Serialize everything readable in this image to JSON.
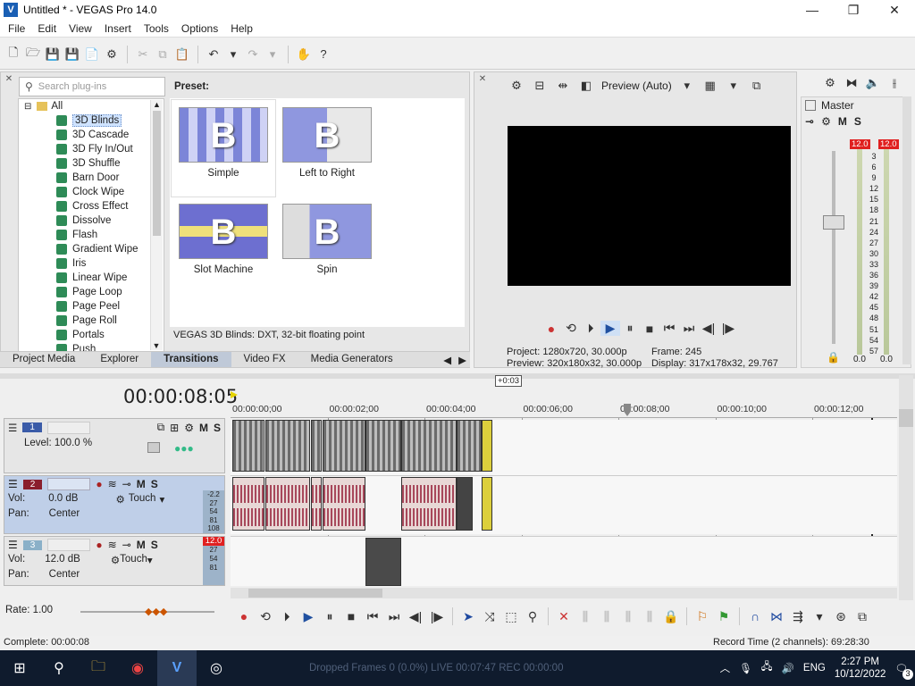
{
  "window": {
    "title": "Untitled * - VEGAS Pro 14.0"
  },
  "menu": [
    "File",
    "Edit",
    "View",
    "Insert",
    "Tools",
    "Options",
    "Help"
  ],
  "plugins": {
    "search_placeholder": "Search plug-ins",
    "root": "All",
    "items": [
      "3D Blinds",
      "3D Cascade",
      "3D Fly In/Out",
      "3D Shuffle",
      "Barn Door",
      "Clock Wipe",
      "Cross Effect",
      "Dissolve",
      "Flash",
      "Gradient Wipe",
      "Iris",
      "Linear Wipe",
      "Page Loop",
      "Page Peel",
      "Page Roll",
      "Portals",
      "Push"
    ],
    "preset_heading": "Preset:",
    "presets": [
      "Simple",
      "Left to Right",
      "Slot Machine",
      "Spin"
    ],
    "preset_glyph": "B",
    "description": "VEGAS 3D Blinds: DXT, 32-bit floating point"
  },
  "tabs": [
    "Project Media",
    "Explorer",
    "Transitions",
    "Video FX",
    "Media Generators"
  ],
  "preview": {
    "mode": "Preview (Auto)",
    "project_label": "Project:",
    "project_value": "1280x720, 30.000p",
    "preview_label": "Preview:",
    "preview_value": "320x180x32, 30.000p",
    "frame_label": "Frame:",
    "frame_value": "245",
    "display_label": "Display:",
    "display_value": "317x178x32, 29.767"
  },
  "mixer": {
    "title": "Master",
    "m": "M",
    "s": "S",
    "peak_l": "12.0",
    "peak_r": "12.0",
    "scale": [
      "3",
      "6",
      "9",
      "12",
      "15",
      "18",
      "21",
      "24",
      "27",
      "30",
      "33",
      "36",
      "39",
      "42",
      "45",
      "48",
      "51",
      "54",
      "57"
    ],
    "val_l": "0.0",
    "val_r": "0.0"
  },
  "timeline": {
    "timecode": "00:00:08:05",
    "offset": "+0:03",
    "ruler": [
      "00:00:00;00",
      "00:00:02;00",
      "00:00:04;00",
      "00:00:06;00",
      "00:00:08;00",
      "00:00:10;00",
      "00:00:12;00"
    ],
    "track1": {
      "num": "1",
      "level": "Level: 100.0 %",
      "m": "M",
      "s": "S"
    },
    "track2": {
      "num": "2",
      "vol_label": "Vol:",
      "vol": "0.0 dB",
      "pan_label": "Pan:",
      "pan": "Center",
      "mode": "Touch",
      "m": "M",
      "s": "S",
      "meter": [
        "-2.2",
        "27",
        "54",
        "81",
        "108"
      ]
    },
    "track3": {
      "num": "3",
      "vol_label": "Vol:",
      "vol": "12.0 dB",
      "pan_label": "Pan:",
      "pan": "Center",
      "mode": "Touch",
      "m": "M",
      "s": "S",
      "peak": "12.0",
      "meter": [
        "27",
        "54",
        "81"
      ]
    },
    "rate": "Rate: 1.00"
  },
  "status": {
    "left": "Complete: 00:00:08",
    "right": "Record Time (2 channels): 69:28:30"
  },
  "taskbar": {
    "ghost": "Dropped Frames 0 (0.0%)     LIVE 00:07:47     REC 00:00:00",
    "lang": "ENG",
    "time": "2:27 PM",
    "date": "10/12/2022",
    "notif": "3"
  }
}
